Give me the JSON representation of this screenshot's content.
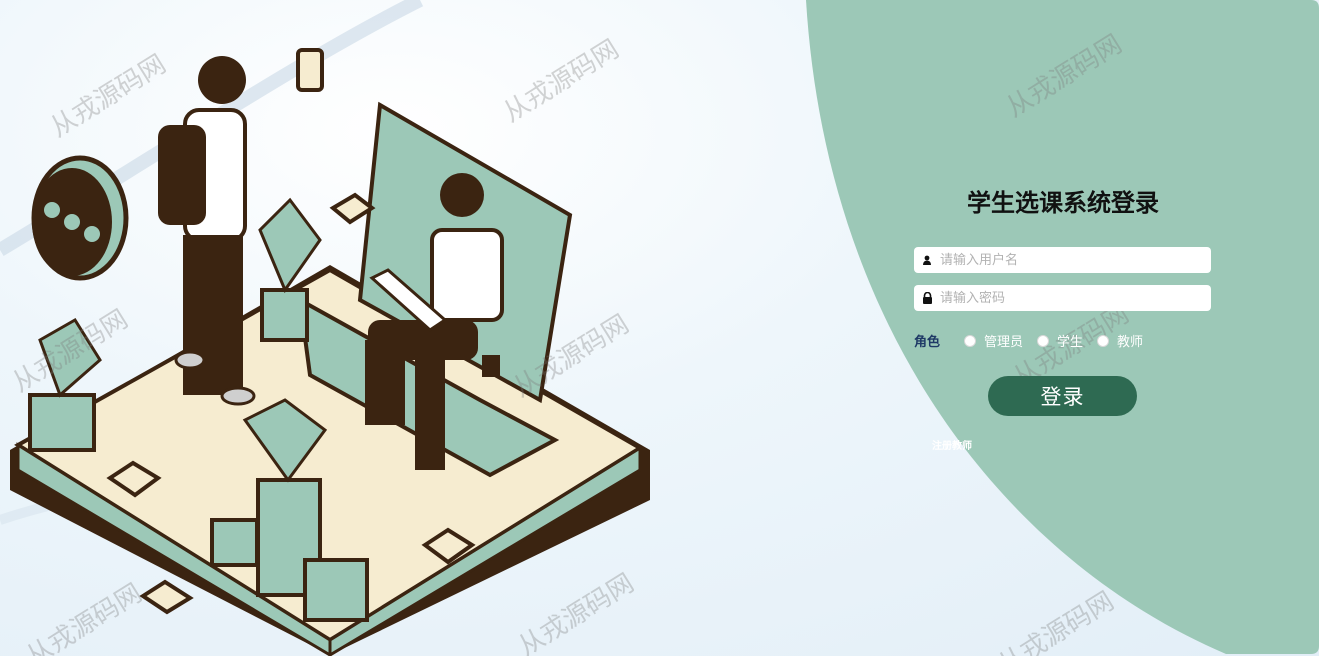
{
  "login": {
    "title": "学生选课系统登录",
    "username_placeholder": "请输入用户名",
    "password_placeholder": "请输入密码",
    "role_label": "角色",
    "roles": [
      "管理员",
      "学生",
      "教师"
    ],
    "submit_label": "登录",
    "register_link": "注册教师"
  },
  "watermark": {
    "text": "从戎源码网"
  },
  "icons": {
    "username": "user-icon",
    "password": "lock-icon"
  },
  "colors": {
    "panel": "#9cc8b7",
    "button": "#2e6a52",
    "role_label": "#1f3a66"
  }
}
